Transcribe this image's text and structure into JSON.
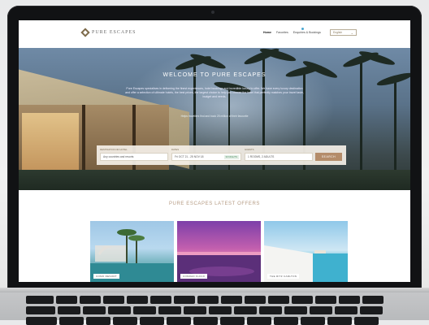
{
  "nav": {
    "brand": "PURE ESCAPES",
    "links": [
      "Home",
      "Favorites",
      "Enquiries & Bookings"
    ],
    "language": "English"
  },
  "hero": {
    "title": "WELCOME TO PURE ESCAPES",
    "subtitle": "Pure Escapes specialises in delivering the finest experiences, hotel bookings and incredible luxury to offer. We have every luxury destination and offer a selection of ultimate hotels, the best prices, the largest choice to help you choose the hotel that perfectly matches your travel taste, budget and needs.",
    "note": "Helps travellers find and book 25 million of their favourite"
  },
  "search": {
    "destination_label": "DESTINATION OR HOTEL",
    "destination_value": "Any countries and resorts",
    "dates_label": "DATES",
    "dates_value": "Fri OCT 21 - 25 NOV 18",
    "nights_badge": "30 NIGHTS",
    "guests_label": "GUESTS",
    "guests_value": "1 ROOMS, 2 ADULTS",
    "button_label": "SEARCH"
  },
  "offers": {
    "title": "PURE ESCAPES LATEST OFFERS",
    "cards": [
      {
        "label": "COMO RESORT"
      },
      {
        "label": "CONRAD FLOJJI"
      },
      {
        "label": "THE RITZ CARLTON"
      }
    ]
  },
  "colors": {
    "accent": "#b48c6a",
    "offers_title": "#b59b83",
    "nav_dot": "#49a7d1"
  }
}
